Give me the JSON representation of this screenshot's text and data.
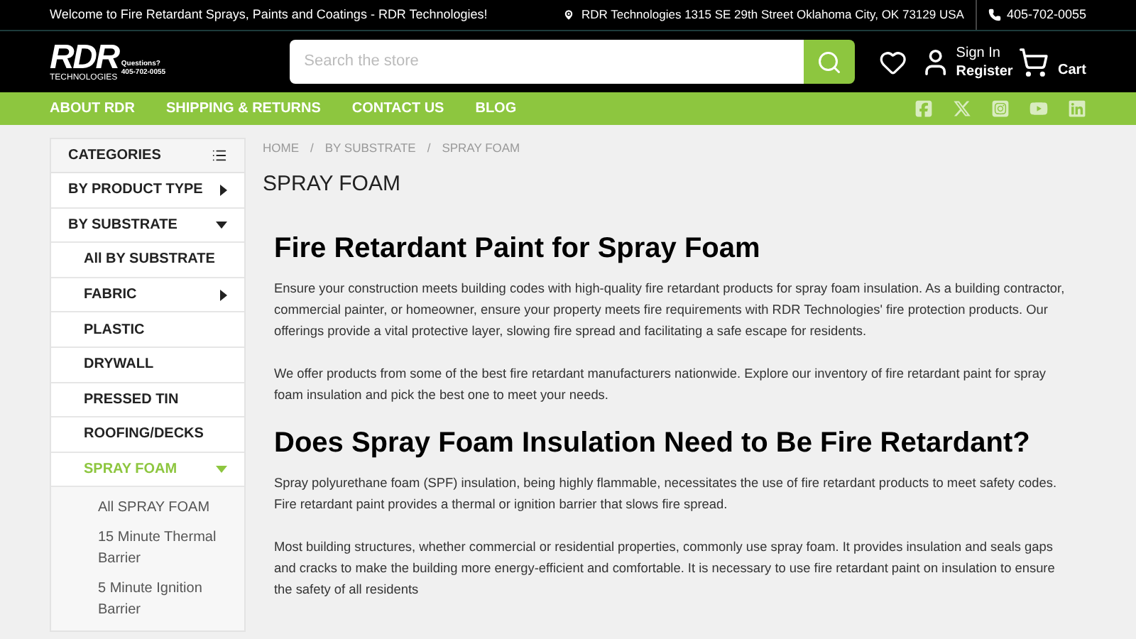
{
  "top_bar": {
    "welcome": "Welcome to Fire Retardant Sprays, Paints and Coatings - RDR Technologies!",
    "address": "RDR Technologies 1315 SE 29th Street Oklahoma City, OK 73129 USA",
    "phone": "405-702-0055"
  },
  "header": {
    "logo": {
      "mark": "RDR",
      "sub": "TECHNOLOGIES",
      "question": "Questions?",
      "phone": "405-702-0055"
    },
    "search": {
      "placeholder": "Search the store"
    },
    "sign_in": "Sign In",
    "register": "Register",
    "cart": "Cart"
  },
  "nav": [
    "ABOUT RDR",
    "SHIPPING & RETURNS",
    "CONTACT US",
    "BLOG"
  ],
  "sidebar": {
    "title": "CATEGORIES",
    "items": [
      {
        "label": "BY PRODUCT TYPE",
        "expanded": false,
        "selected": false
      },
      {
        "label": "BY SUBSTRATE",
        "expanded": true,
        "selected": false,
        "children": [
          {
            "label": "All BY SUBSTRATE",
            "selected": false
          },
          {
            "label": "FABRIC",
            "expanded": false,
            "selected": false
          },
          {
            "label": "PLASTIC",
            "selected": false
          },
          {
            "label": "DRYWALL",
            "selected": false
          },
          {
            "label": "PRESSED TIN",
            "selected": false
          },
          {
            "label": "ROOFING/DECKS",
            "selected": false
          },
          {
            "label": "SPRAY FOAM",
            "expanded": true,
            "selected": true,
            "children": [
              {
                "label": "All SPRAY FOAM",
                "selected": false
              },
              {
                "label": "15 Minute Thermal Barrier",
                "selected": false
              },
              {
                "label": "5 Minute Ignition Barrier",
                "selected": false
              }
            ]
          }
        ]
      }
    ]
  },
  "breadcrumbs": [
    "HOME",
    "BY SUBSTRATE",
    "SPRAY FOAM"
  ],
  "breadcrumb_separators": [
    "/",
    "/"
  ],
  "page_title": "SPRAY FOAM",
  "sections": [
    {
      "heading": "Fire Retardant Paint for Spray Foam",
      "paragraphs": [
        "Ensure your construction meets building codes with high-quality fire retardant products for spray foam insulation. As a building contractor, commercial painter, or homeowner, ensure your property meets fire requirements with RDR Technologies' fire protection products. Our offerings provide a vital protective layer, slowing fire spread and facilitating a safe escape for residents.",
        "We offer products from some of the best fire retardant manufacturers nationwide. Explore our inventory of fire retardant paint for spray foam insulation and pick the best one to meet your needs."
      ]
    },
    {
      "heading": "Does Spray Foam Insulation Need to Be Fire Retardant?",
      "paragraphs": [
        "Spray polyurethane foam (SPF) insulation, being highly flammable, necessitates the use of fire retardant products to meet safety codes. Fire retardant paint provides a thermal or ignition barrier that slows fire spread.",
        "Most building structures, whether commercial or residential properties, commonly use spray foam. It provides insulation and seals gaps and cracks to make the building more energy-efficient and comfortable. It is necessary to use fire retardant paint on insulation to ensure the safety of all residents"
      ]
    }
  ]
}
